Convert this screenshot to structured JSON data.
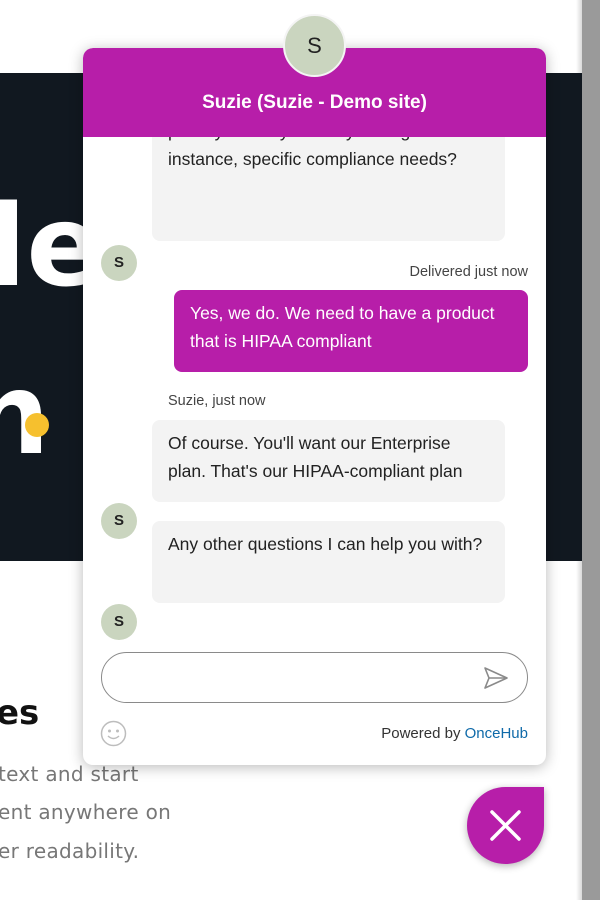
{
  "website": {
    "hero_word_1": "le",
    "hero_word_2": "n",
    "section_heading": "es",
    "section_lines": [
      "text and start",
      "ent anywhere on",
      "er readability."
    ]
  },
  "chat": {
    "title": "Suzie (Suzie - Demo site)",
    "header_avatar_initial": "S",
    "messages": [
      {
        "from": "bot",
        "avatar": "S",
        "text": "privacy/security needs your org has? For instance, specific compliance needs?"
      },
      {
        "from": "user",
        "status": "Delivered just now",
        "text": "Yes, we do. We need to have a product that is HIPAA compliant"
      },
      {
        "from": "bot",
        "avatar": "S",
        "meta": "Suzie, just now",
        "text": "Of course. You'll want our Enterprise plan. That's our HIPAA-compliant plan"
      },
      {
        "from": "bot",
        "avatar": "S",
        "text": "Any other questions I can help you with?"
      }
    ],
    "input": {
      "value": "",
      "placeholder": ""
    },
    "send_icon": "send-icon",
    "emoji_icon": "smiley-icon",
    "powered_by_prefix": "Powered by",
    "powered_by_brand": "OnceHub"
  },
  "fab": {
    "icon": "close-icon"
  },
  "colors": {
    "brand_purple": "#b71ea9",
    "avatar_green": "#cad5bf",
    "hero_dark": "#111820",
    "accent_yellow": "#f6c02e",
    "link_blue": "#0f6aa9"
  }
}
